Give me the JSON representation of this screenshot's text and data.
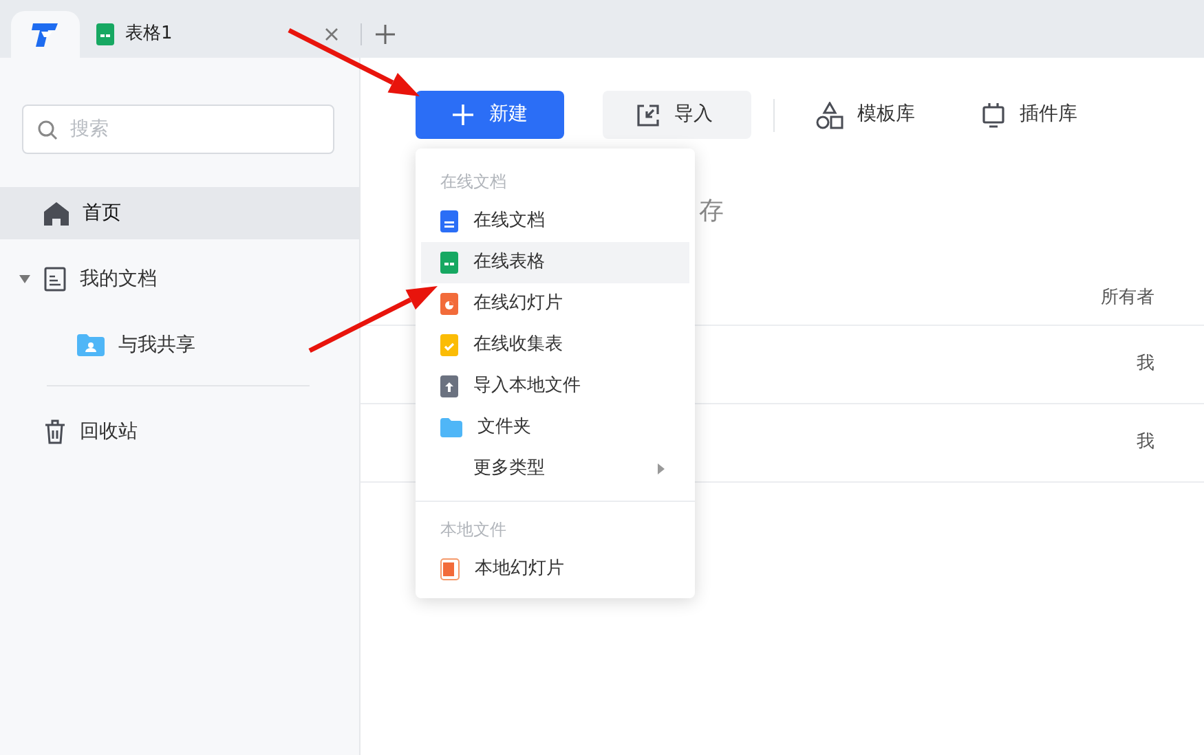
{
  "tabs": [
    {
      "kind": "home",
      "selected": true
    },
    {
      "kind": "sheet",
      "label": "表格1",
      "selected": false
    }
  ],
  "sidebar": {
    "search": {
      "placeholder": "搜索"
    },
    "items": [
      {
        "kind": "home",
        "label": "首页",
        "selected": true
      },
      {
        "kind": "docs",
        "label": "我的文档",
        "selected": false,
        "expanded": true,
        "children": [
          {
            "kind": "shared",
            "label": "与我共享",
            "selected": false
          }
        ]
      },
      {
        "kind": "trash",
        "label": "回收站",
        "selected": false
      }
    ]
  },
  "toolbar": {
    "new_button": {
      "label": "新建"
    },
    "actions": [
      {
        "kind": "import",
        "label": "导入"
      },
      {
        "kind": "templates",
        "label": "模板库"
      },
      {
        "kind": "plugins",
        "label": "插件库"
      }
    ]
  },
  "section_title": "存",
  "table": {
    "columns": [
      {
        "label": "所有者"
      }
    ],
    "rows": [
      {
        "owner": "我"
      },
      {
        "owner": "我"
      }
    ]
  },
  "new_menu": {
    "groups": [
      {
        "label": "在线文档",
        "items": [
          {
            "kind": "doc",
            "label": "在线文档",
            "selected": false
          },
          {
            "kind": "sheet",
            "label": "在线表格",
            "selected": true
          },
          {
            "kind": "slides",
            "label": "在线幻灯片",
            "selected": false
          },
          {
            "kind": "form",
            "label": "在线收集表",
            "selected": false
          },
          {
            "kind": "upload",
            "label": "导入本地文件",
            "selected": false
          },
          {
            "kind": "folder",
            "label": "文件夹",
            "selected": false
          },
          {
            "kind": "more",
            "label": "更多类型",
            "selected": false
          }
        ]
      },
      {
        "label": "本地文件",
        "items": [
          {
            "kind": "local_slides",
            "label": "本地幻灯片",
            "selected": false
          }
        ]
      }
    ]
  },
  "annotations": [
    {
      "kind": "arrow"
    },
    {
      "kind": "arrow"
    }
  ]
}
